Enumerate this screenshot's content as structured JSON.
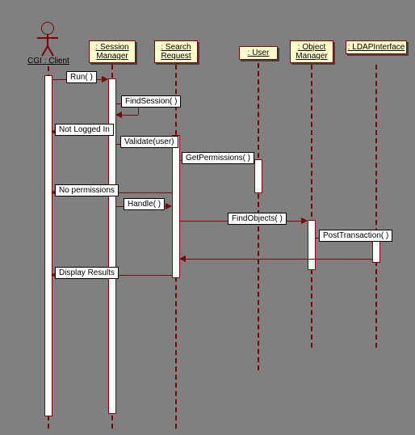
{
  "diagram_type": "UML Sequence Diagram",
  "actors": {
    "client": {
      "label": "CGI : Client"
    }
  },
  "lifelines": {
    "session_manager": {
      "label": " : Session\nManager"
    },
    "search_request": {
      "label": " : Search\nRequest"
    },
    "user": {
      "label": " : User"
    },
    "object_manager": {
      "label": " : Object\nManager"
    },
    "ldap_interface": {
      "label": " : \nLDAPInterface"
    }
  },
  "messages": {
    "run": "Run( )",
    "find_session": "FindSession( )",
    "not_logged_in": "Not Logged In",
    "validate": "Validate(user)",
    "get_permissions": "GetPermissions( )",
    "no_permissions": "No permissions",
    "handle": "Handle( )",
    "find_objects": "FindObjects( )",
    "post_transaction": "PostTransaction( )",
    "display_results": "Display Results"
  },
  "chart_data": {
    "type": "sequence_diagram",
    "participants": [
      "CGI : Client",
      "Session Manager",
      "Search Request",
      "User",
      "Object Manager",
      "LDAPInterface"
    ],
    "interactions": [
      {
        "from": "CGI : Client",
        "to": "Session Manager",
        "label": "Run( )",
        "kind": "call"
      },
      {
        "from": "Session Manager",
        "to": "Session Manager",
        "label": "FindSession( )",
        "kind": "self"
      },
      {
        "from": "Session Manager",
        "to": "CGI : Client",
        "label": "Not Logged In",
        "kind": "return"
      },
      {
        "from": "Session Manager",
        "to": "Search Request",
        "label": "Validate(user)",
        "kind": "call"
      },
      {
        "from": "Search Request",
        "to": "User",
        "label": "GetPermissions( )",
        "kind": "call"
      },
      {
        "from": "Search Request",
        "to": "CGI : Client",
        "label": "No permissions",
        "kind": "return"
      },
      {
        "from": "Session Manager",
        "to": "Search Request",
        "label": "Handle( )",
        "kind": "call"
      },
      {
        "from": "Search Request",
        "to": "Object Manager",
        "label": "FindObjects( )",
        "kind": "call"
      },
      {
        "from": "Object Manager",
        "to": "LDAPInterface",
        "label": "PostTransaction( )",
        "kind": "call"
      },
      {
        "from": "LDAPInterface",
        "to": "Search Request",
        "label": "",
        "kind": "return"
      },
      {
        "from": "Search Request",
        "to": "CGI : Client",
        "label": "Display Results",
        "kind": "return"
      }
    ]
  }
}
